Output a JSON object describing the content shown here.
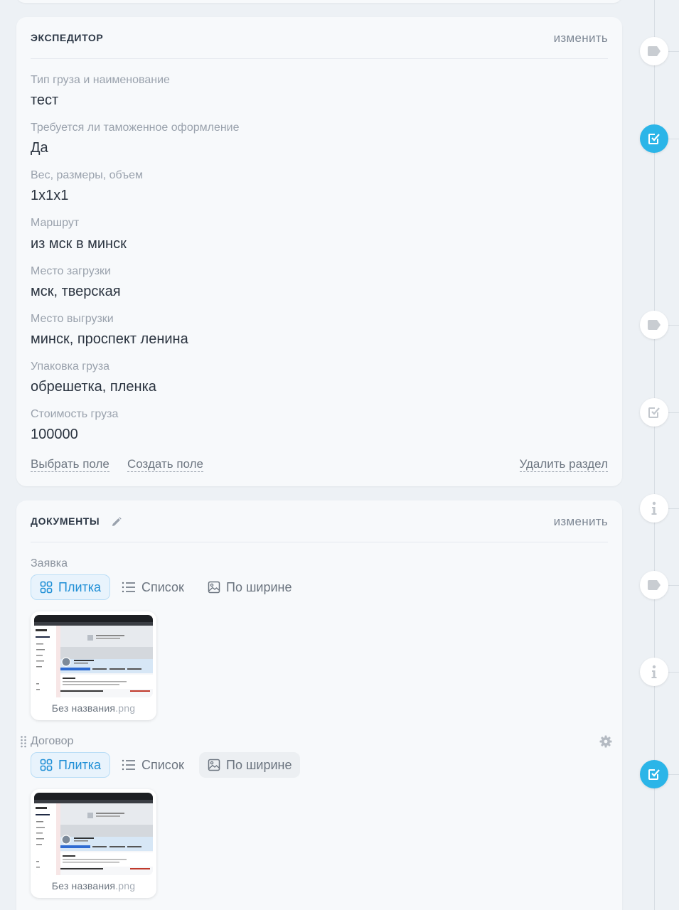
{
  "expeditor": {
    "title": "ЭКСПЕДИТОР",
    "edit_label": "изменить",
    "fields": [
      {
        "label": "Тип груза и наименование",
        "value": "тест"
      },
      {
        "label": "Требуется ли таможенное оформление",
        "value": "Да"
      },
      {
        "label": "Вес, размеры, объем",
        "value": "1x1x1"
      },
      {
        "label": "Маршрут",
        "value": "из мск в минск"
      },
      {
        "label": "Место загрузки",
        "value": "мск, тверская"
      },
      {
        "label": "Место выгрузки",
        "value": "минск, проспект ленина"
      },
      {
        "label": "Упаковка груза",
        "value": "обрешетка, пленка"
      },
      {
        "label": "Стоимость груза",
        "value": "100000"
      }
    ],
    "select_field": "Выбрать поле",
    "create_field": "Создать поле",
    "delete_section": "Удалить раздел"
  },
  "documents": {
    "title": "ДОКУМЕНТЫ",
    "edit_label": "изменить",
    "groups": [
      {
        "label": "Заявка",
        "views": [
          "Плитка",
          "Список",
          "По ширине"
        ],
        "file": {
          "name": "Без названия",
          "ext": ".png"
        }
      },
      {
        "label": "Договор",
        "views": [
          "Плитка",
          "Список",
          "По ширине"
        ],
        "file": {
          "name": "Без названия",
          "ext": ".png"
        }
      }
    ]
  },
  "timeline": {
    "nodes": [
      "tag-icon",
      "checkbox-icon",
      "tag-icon",
      "checkbox-icon",
      "info-icon",
      "tag-icon",
      "info-icon",
      "checkbox-icon"
    ],
    "accent": "#2bb5e8"
  }
}
